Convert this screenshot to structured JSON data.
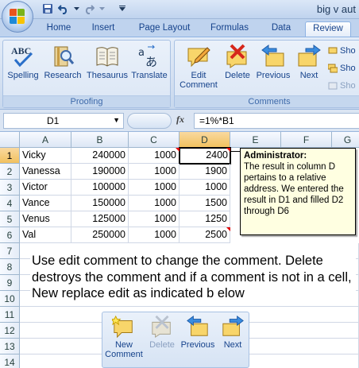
{
  "window": {
    "title": "big v aut"
  },
  "quick_access": {
    "items": [
      "save-icon",
      "undo-icon",
      "redo-icon",
      "customize-icon"
    ]
  },
  "ribbon_tabs": [
    "Home",
    "Insert",
    "Page Layout",
    "Formulas",
    "Data",
    "Review"
  ],
  "active_tab": "Review",
  "proofing_group": {
    "label": "Proofing",
    "buttons": [
      "Spelling",
      "Research",
      "Thesaurus",
      "Translate"
    ]
  },
  "comments_group": {
    "label": "Comments",
    "buttons": [
      "Edit Comment",
      "Delete",
      "Previous",
      "Next"
    ],
    "edit_line1": "Edit",
    "edit_line2": "Comment",
    "side_items": [
      "Sho",
      "Sho",
      "Sho"
    ]
  },
  "formula_bar": {
    "name_box": "D1",
    "fx_label": "fx",
    "formula": "=1%*B1"
  },
  "grid": {
    "columns": [
      "A",
      "B",
      "C",
      "D",
      "E",
      "F",
      "G"
    ],
    "rows": [
      "1",
      "2",
      "3",
      "4",
      "5",
      "6",
      "7",
      "8",
      "9",
      "10",
      "11",
      "12",
      "13",
      "14"
    ],
    "data": [
      [
        "Vicky",
        "240000",
        "1000",
        "2400"
      ],
      [
        "Vanessa",
        "190000",
        "1000",
        "1900"
      ],
      [
        "Victor",
        "100000",
        "1000",
        "1000"
      ],
      [
        "Vance",
        "150000",
        "1000",
        "1500"
      ],
      [
        "Venus",
        "125000",
        "1000",
        "1250"
      ],
      [
        "Val",
        "250000",
        "1000",
        "2500"
      ]
    ]
  },
  "comment": {
    "author": "Administrator:",
    "text": "The result in column D pertains to a relative address. We entered the result in D1 and filled D2 through D6"
  },
  "instruction": {
    "text": "Use edit comment to change the comment. Delete destroys the comment and if a comment is not in a cell, New replace edit as indicated b elow"
  },
  "mini_group": {
    "new_line1": "New",
    "new_line2": "Comment",
    "delete": "Delete",
    "previous": "Previous",
    "next": "Next"
  },
  "colors": {
    "ribbon_text": "#15428b",
    "active_cell_header": "#f1c15f",
    "comment_bg": "#ffffe1",
    "comment_indicator": "#e30000"
  }
}
